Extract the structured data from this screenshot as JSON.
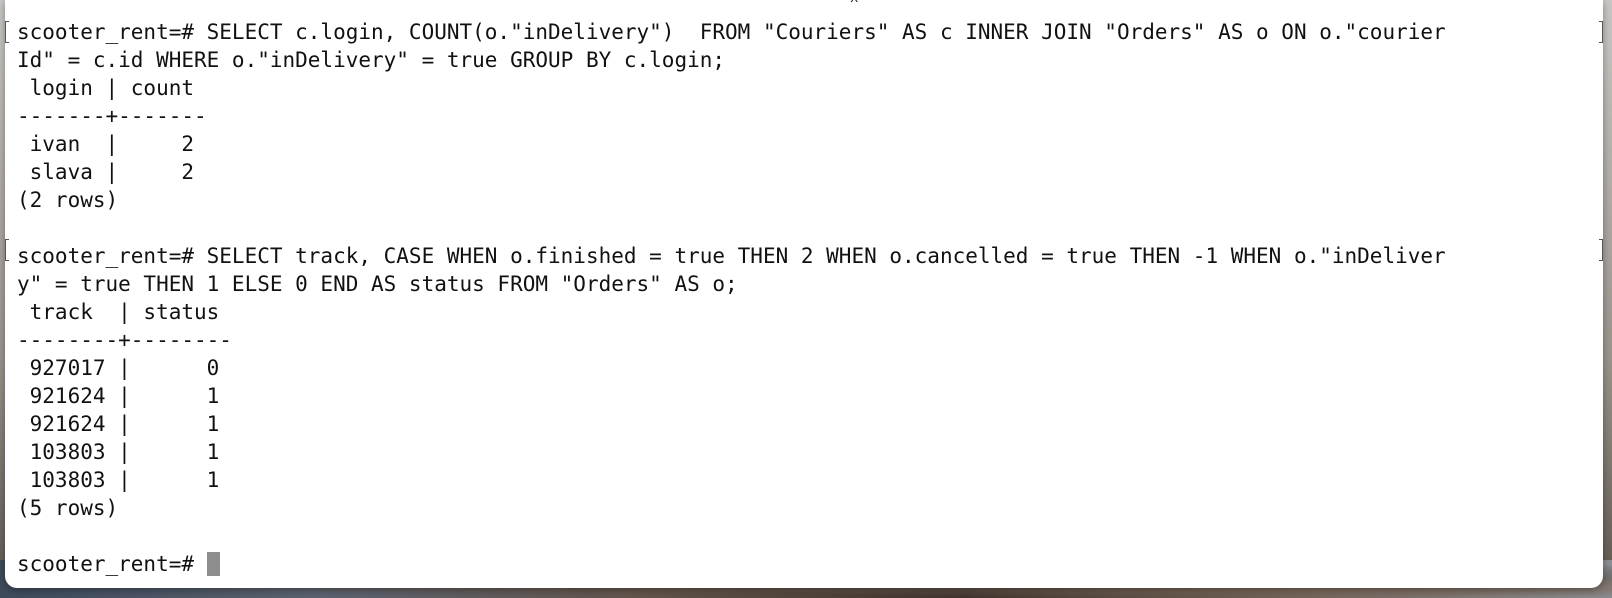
{
  "terminal": {
    "lines": [
      "scooter_rent=# SELECT c.login, COUNT(o.\"inDelivery\")  FROM \"Couriers\" AS c INNER JOIN \"Orders\" AS o ON o.\"courier",
      "Id\" = c.id WHERE o.\"inDelivery\" = true GROUP BY c.login;",
      " login | count",
      "-------+-------",
      " ivan  |     2",
      " slava |     2",
      "(2 rows)",
      "",
      "scooter_rent=# SELECT track, CASE WHEN o.finished = true THEN 2 WHEN o.cancelled = true THEN -1 WHEN o.\"inDeliver",
      "y\" = true THEN 1 ELSE 0 END AS status FROM \"Orders\" AS o;",
      " track  | status",
      "--------+--------",
      " 927017 |      0",
      " 921624 |      1",
      " 921624 |      1",
      " 103803 |      1",
      " 103803 |      1",
      "(5 rows)",
      "",
      "scooter_rent=# "
    ],
    "top_mark": "x"
  }
}
